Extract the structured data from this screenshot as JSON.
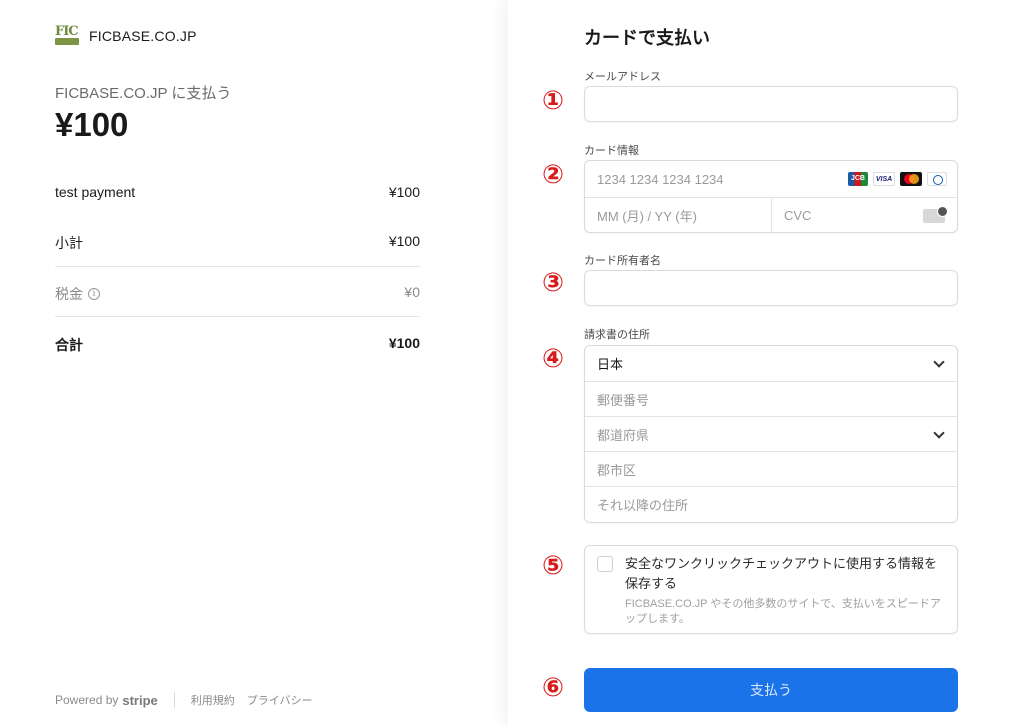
{
  "merchant": {
    "name": "FICBASE.CO.JP",
    "pay_to": "FICBASE.CO.JP に支払う",
    "amount": "¥100"
  },
  "summary": {
    "item": {
      "label": "test payment",
      "value": "¥100"
    },
    "subtotal": {
      "label": "小計",
      "value": "¥100"
    },
    "tax": {
      "label": "税金",
      "value": "¥0"
    },
    "total": {
      "label": "合計",
      "value": "¥100"
    }
  },
  "footer": {
    "powered_by": "Powered by",
    "stripe": "stripe",
    "terms": "利用規約",
    "privacy": "プライバシー"
  },
  "form": {
    "title": "カードで支払い",
    "email_label": "メールアドレス",
    "email_value": "",
    "card_label": "カード情報",
    "card_number_placeholder": "1234 1234 1234 1234",
    "card_brands": [
      "JCB",
      "VISA",
      "Mastercard",
      "Diners"
    ],
    "expiry_placeholder": "MM (月) / YY (年)",
    "cvc_placeholder": "CVC",
    "holder_label": "カード所有者名",
    "holder_value": "",
    "address_label": "請求書の住所",
    "country_value": "日本",
    "postal_placeholder": "郵便番号",
    "prefecture_placeholder": "都道府県",
    "city_placeholder": "郡市区",
    "address_placeholder": "それ以降の住所",
    "save_title": "安全なワンクリックチェックアウトに使用する情報を保存する",
    "save_desc": "FICBASE.CO.JP やその他多数のサイトで、支払いをスピードアップします。",
    "pay_button": "支払う"
  },
  "annotations": [
    "①",
    "②",
    "③",
    "④",
    "⑤",
    "⑥"
  ],
  "colors": {
    "accent": "#1a73e8",
    "annotation": "#d81a1a"
  }
}
